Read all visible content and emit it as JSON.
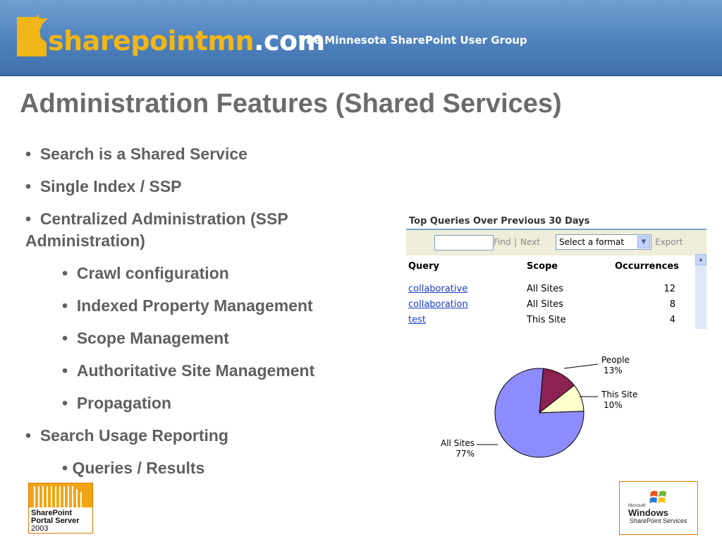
{
  "header": {
    "brand_part1": "sharepointmn",
    "brand_part2": ".com",
    "tagline": "The Minnesota SharePoint User Group"
  },
  "slide": {
    "title": "Administration Features (Shared Services)",
    "bullets": [
      {
        "text": "Search is a Shared Service",
        "level": 1
      },
      {
        "text": "Single Index / SSP",
        "level": 1
      },
      {
        "text": "Centralized Administration (SSP",
        "level": 1
      },
      {
        "text": "Administration)",
        "level": 1
      },
      {
        "text": "Crawl configuration",
        "level": 2
      },
      {
        "text": "Indexed Property Management",
        "level": 2
      },
      {
        "text": "Scope Management",
        "level": 2
      },
      {
        "text": "Authoritative Site Management",
        "level": 2
      },
      {
        "text": "Propagation",
        "level": 2
      },
      {
        "text": "Search Usage Reporting",
        "level": 1
      },
      {
        "text": "• Queries / Results",
        "level": 2
      }
    ]
  },
  "report": {
    "title": "Top Queries Over Previous 30 Days",
    "find_value": "",
    "find_label": "Find",
    "separator": "|",
    "next_label": "Next",
    "format_select": "Select a format",
    "export_label": "Export",
    "columns": [
      "Query",
      "Scope",
      "Occurrences"
    ],
    "rows": [
      {
        "query": "collaborative",
        "scope": "All Sites",
        "occurrences": "12"
      },
      {
        "query": "collaboration",
        "scope": "All Sites",
        "occurrences": "8"
      },
      {
        "query": "test",
        "scope": "This Site",
        "occurrences": "4"
      }
    ]
  },
  "chart_data": {
    "type": "pie",
    "series": [
      {
        "label": "All Sites",
        "value": 77,
        "display": "77%",
        "color": "#8c8cff"
      },
      {
        "label": "People",
        "value": 13,
        "display": "13%",
        "color": "#8b2252"
      },
      {
        "label": "This Site",
        "value": 10,
        "display": "10%",
        "color": "#ffffcc"
      }
    ]
  },
  "logos": {
    "left_line1": "SharePoint",
    "left_line2": "Portal Server",
    "left_line3": "2003",
    "right_ms": "Microsoft",
    "right_windows": "Windows",
    "right_sps": "SharePoint Services"
  },
  "colors": {
    "banner": "#4f82bd",
    "brand_accent": "#f2b618",
    "title_text": "#6b6b6b",
    "link": "#1a3ccb"
  }
}
